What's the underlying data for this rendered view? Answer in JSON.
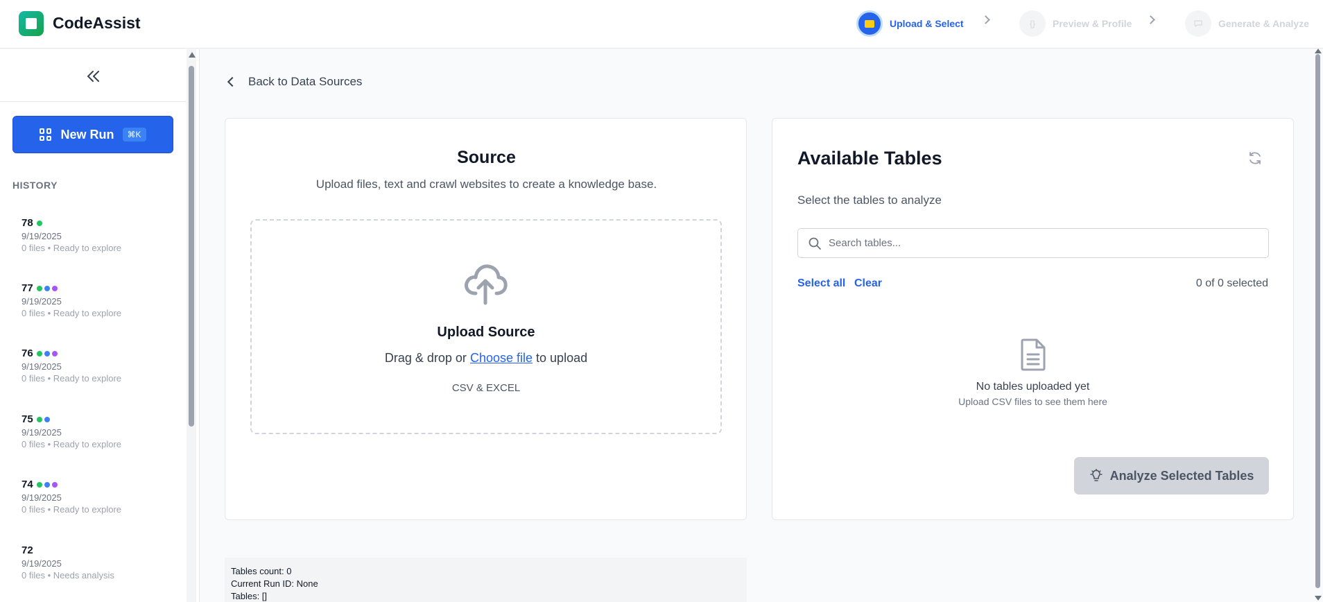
{
  "app": {
    "title": "CodeAssist"
  },
  "steps": [
    {
      "label": "Upload & Select",
      "state": "active"
    },
    {
      "label": "Preview & Profile",
      "icon": "{}",
      "state": "inactive"
    },
    {
      "label": "Generate & Analyze",
      "state": "inactive"
    }
  ],
  "sidebar": {
    "new_run_label": "New Run",
    "shortcut": "⌘K",
    "history_title": "HISTORY",
    "history": [
      {
        "num": "78",
        "dots": [
          "#22c55e"
        ],
        "date": "9/19/2025",
        "status": "0 files • Ready to explore"
      },
      {
        "num": "77",
        "dots": [
          "#22c55e",
          "#3b82f6",
          "#a855f7"
        ],
        "date": "9/19/2025",
        "status": "0 files • Ready to explore"
      },
      {
        "num": "76",
        "dots": [
          "#22c55e",
          "#3b82f6",
          "#a855f7"
        ],
        "date": "9/19/2025",
        "status": "0 files • Ready to explore"
      },
      {
        "num": "75",
        "dots": [
          "#22c55e",
          "#3b82f6"
        ],
        "date": "9/19/2025",
        "status": "0 files • Ready to explore"
      },
      {
        "num": "74",
        "dots": [
          "#22c55e",
          "#3b82f6",
          "#a855f7"
        ],
        "date": "9/19/2025",
        "status": "0 files • Ready to explore"
      },
      {
        "num": "72",
        "dots": [],
        "date": "9/19/2025",
        "status": "0 files • Needs analysis"
      }
    ]
  },
  "main": {
    "back_label": "Back to Data Sources",
    "source": {
      "title": "Source",
      "subtitle": "Upload files, text and crawl websites to create a knowledge base.",
      "upload_title": "Upload Source",
      "drag_text": "Drag & drop or",
      "choose_file": "Choose file",
      "to_upload": "to upload",
      "types": "CSV & EXCEL"
    },
    "tables": {
      "title": "Available Tables",
      "subtitle": "Select the tables to analyze",
      "search_placeholder": "Search tables...",
      "select_all": "Select all",
      "clear": "Clear",
      "selected_count": "0 of 0 selected",
      "empty_title": "No tables uploaded yet",
      "empty_sub": "Upload CSV files to see them here",
      "analyze_label": "Analyze Selected Tables"
    },
    "debug": {
      "tables_count": "Tables count: 0",
      "current_run": "Current Run ID: None",
      "tables": "Tables: []"
    }
  },
  "colors": {
    "accent": "#2563eb",
    "disabled_button": "#d1d5db"
  }
}
